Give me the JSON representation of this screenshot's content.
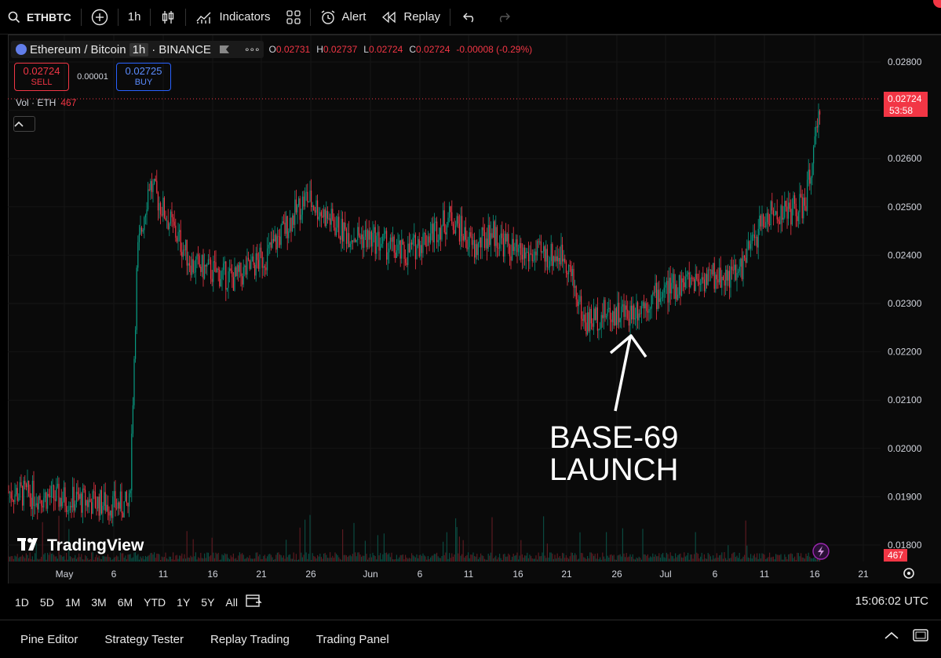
{
  "topbar": {
    "symbol": "ETHBTC",
    "interval": "1h",
    "indicators_label": "Indicators",
    "alert_label": "Alert",
    "replay_label": "Replay"
  },
  "legend": {
    "name": "Ethereum / Bitcoin",
    "interval": "1h",
    "exchange": "BINANCE",
    "more": "∘∘∘",
    "o_label": "O",
    "o": "0.02731",
    "h_label": "H",
    "h": "0.02737",
    "l_label": "L",
    "l": "0.02724",
    "c_label": "C",
    "c": "0.02724",
    "change": "-0.00008 (-0.29%)"
  },
  "trade": {
    "sell_price": "0.02724",
    "sell_label": "SELL",
    "spread": "0.00001",
    "buy_price": "0.02725",
    "buy_label": "BUY"
  },
  "volume": {
    "label": "Vol · ETH",
    "value": "467"
  },
  "price_scale": {
    "ticks": [
      "0.02800",
      "0.02700",
      "0.02600",
      "0.02500",
      "0.02400",
      "0.02300",
      "0.02200",
      "0.02100",
      "0.02000",
      "0.01900",
      "0.01800"
    ],
    "current_price": "0.02724",
    "countdown": "53:58",
    "vol_badge": "467"
  },
  "time_axis": {
    "labels": [
      "May",
      "6",
      "11",
      "16",
      "21",
      "26",
      "Jun",
      "6",
      "11",
      "16",
      "21",
      "26",
      "Jul",
      "6",
      "11",
      "16",
      "21"
    ]
  },
  "annotation": {
    "line1": "BASE-69",
    "line2": "LAUNCH"
  },
  "watermark": "TradingView",
  "ranges": [
    "1D",
    "5D",
    "1M",
    "3M",
    "6M",
    "YTD",
    "1Y",
    "5Y",
    "All"
  ],
  "time_utc": "15:06:02 UTC",
  "bottom_tabs": [
    "Pine Editor",
    "Strategy Tester",
    "Replay Trading",
    "Trading Panel"
  ],
  "colors": {
    "up": "#089981",
    "down": "#f23645",
    "background": "#000000",
    "text": "#d1d4dc"
  },
  "chart_data": {
    "type": "line",
    "y_axis": [
      0.0178,
      0.0281
    ],
    "x": [
      "May",
      "6",
      "11",
      "16",
      "21",
      "26",
      "Jun",
      "6",
      "11",
      "16",
      "21",
      "26",
      "Jul",
      "6",
      "11",
      "16"
    ],
    "series": [
      {
        "values": [
          0.0191,
          0.019,
          0.0188,
          0.024,
          0.0255,
          0.0238,
          0.0235,
          0.024,
          0.0252,
          0.0245,
          0.0243,
          0.024,
          0.0248,
          0.0241,
          0.0245,
          0.024,
          0.024,
          0.0226,
          0.0228,
          0.0228,
          0.0232,
          0.0235,
          0.0236,
          0.0248,
          0.025,
          0.027
        ]
      }
    ]
  }
}
